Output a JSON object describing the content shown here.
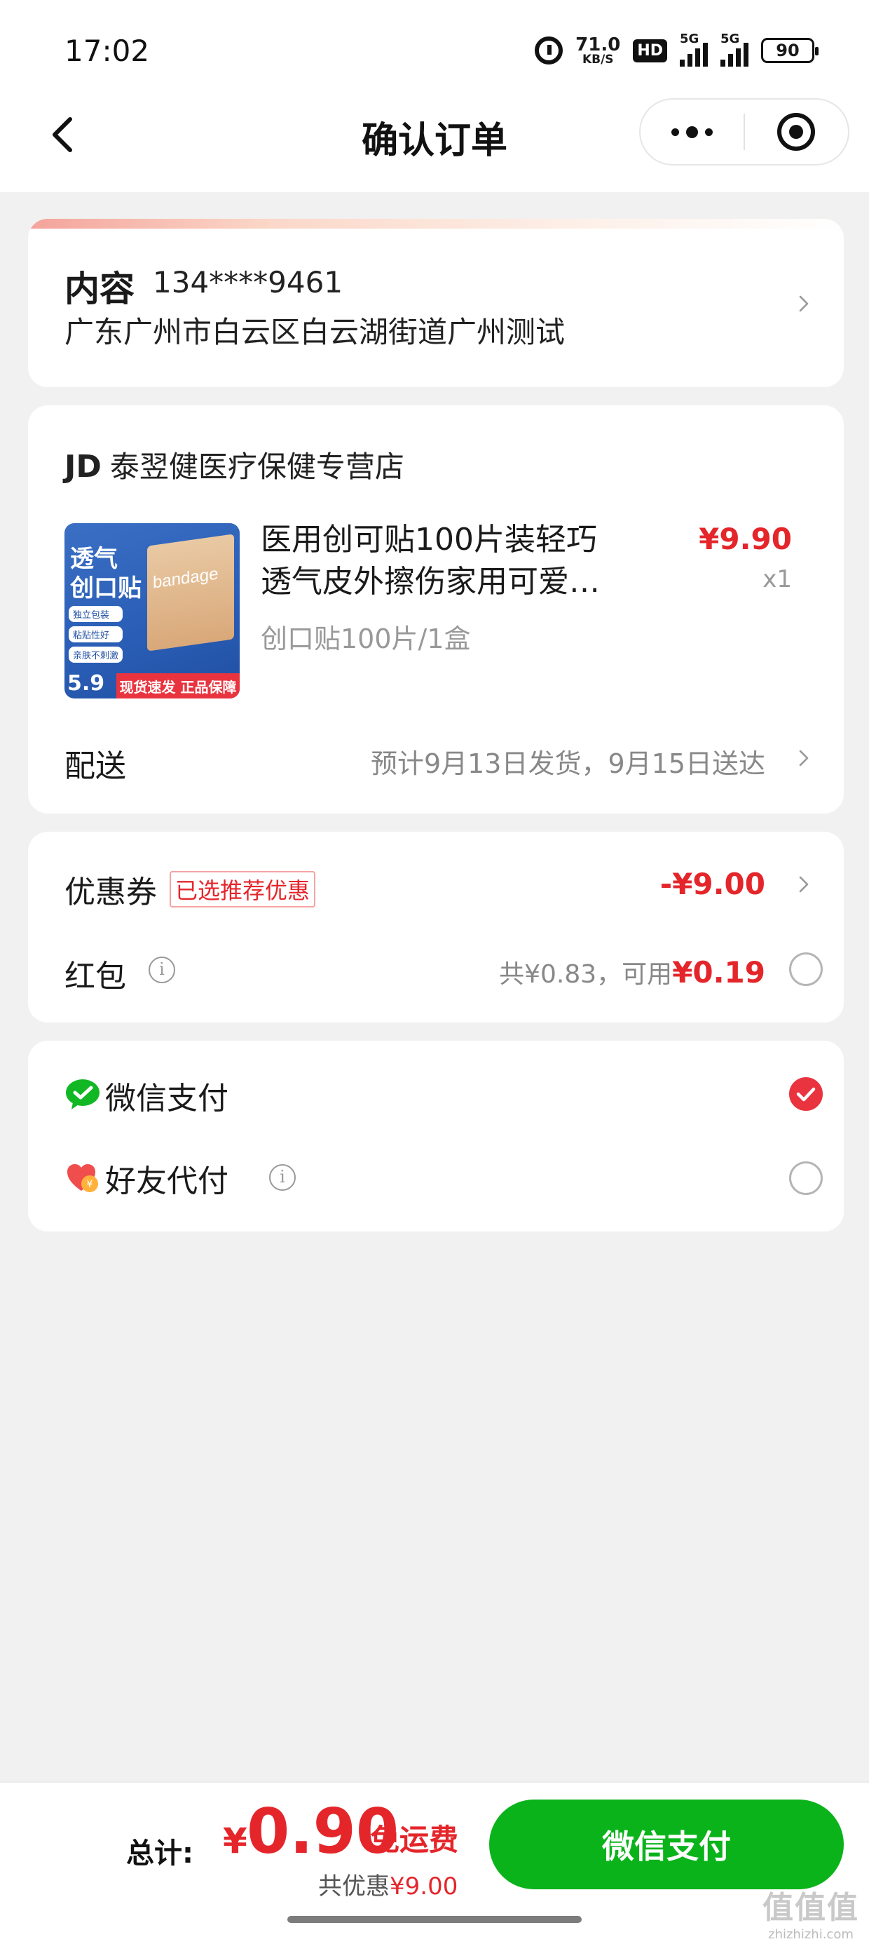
{
  "status_bar": {
    "time": "17:02",
    "net_speed_value": "71.0",
    "net_speed_unit": "KB/S",
    "hd_label": "HD",
    "signal1_label": "5G",
    "signal2_label": "5G",
    "battery": "90"
  },
  "nav": {
    "title": "确认订单"
  },
  "address": {
    "name": "内容",
    "phone": "134****9461",
    "line": "广东广州市白云区白云湖街道广州测试"
  },
  "shop": {
    "prefix": "JD",
    "name": "泰翌健医疗保健专营店",
    "product": {
      "title": "医用创可贴100片装轻巧透气皮外擦伤家用可爱…",
      "price": "¥9.90",
      "qty": "x1",
      "spec": "创口贴100片/1盒",
      "image": {
        "title_line1": "透气",
        "title_line2": "创口贴",
        "tags": [
          "独立包装",
          "粘贴性好",
          "亲肤不刺激"
        ],
        "price": "5.9",
        "strip": "现货速发 正品保障",
        "box_text": "bandage"
      }
    },
    "delivery": {
      "label": "配送",
      "value": "预计9月13日发货，9月15日送达"
    }
  },
  "discount": {
    "coupon_label": "优惠券",
    "coupon_tag": "已选推荐优惠",
    "coupon_value": "-¥9.00",
    "hongbao_label": "红包",
    "hongbao_total_prefix": "共¥0.83，可用",
    "hongbao_available": "¥0.19"
  },
  "payment": {
    "wechat_label": "微信支付",
    "friend_label": "好友代付",
    "wechat_selected": true,
    "friend_selected": false
  },
  "bottom": {
    "total_label": "总计:",
    "currency": "¥",
    "amount": "0.90",
    "free_shipping": "免运费",
    "saved_prefix": "共优惠",
    "saved_value": "¥9.00",
    "pay_button": "微信支付"
  },
  "watermark": {
    "logo": "值值值",
    "url": "zhizhizhi.com"
  },
  "colors": {
    "accent_red": "#e4262b",
    "wechat_green": "#0ab31a",
    "background": "#f1f1f1"
  }
}
